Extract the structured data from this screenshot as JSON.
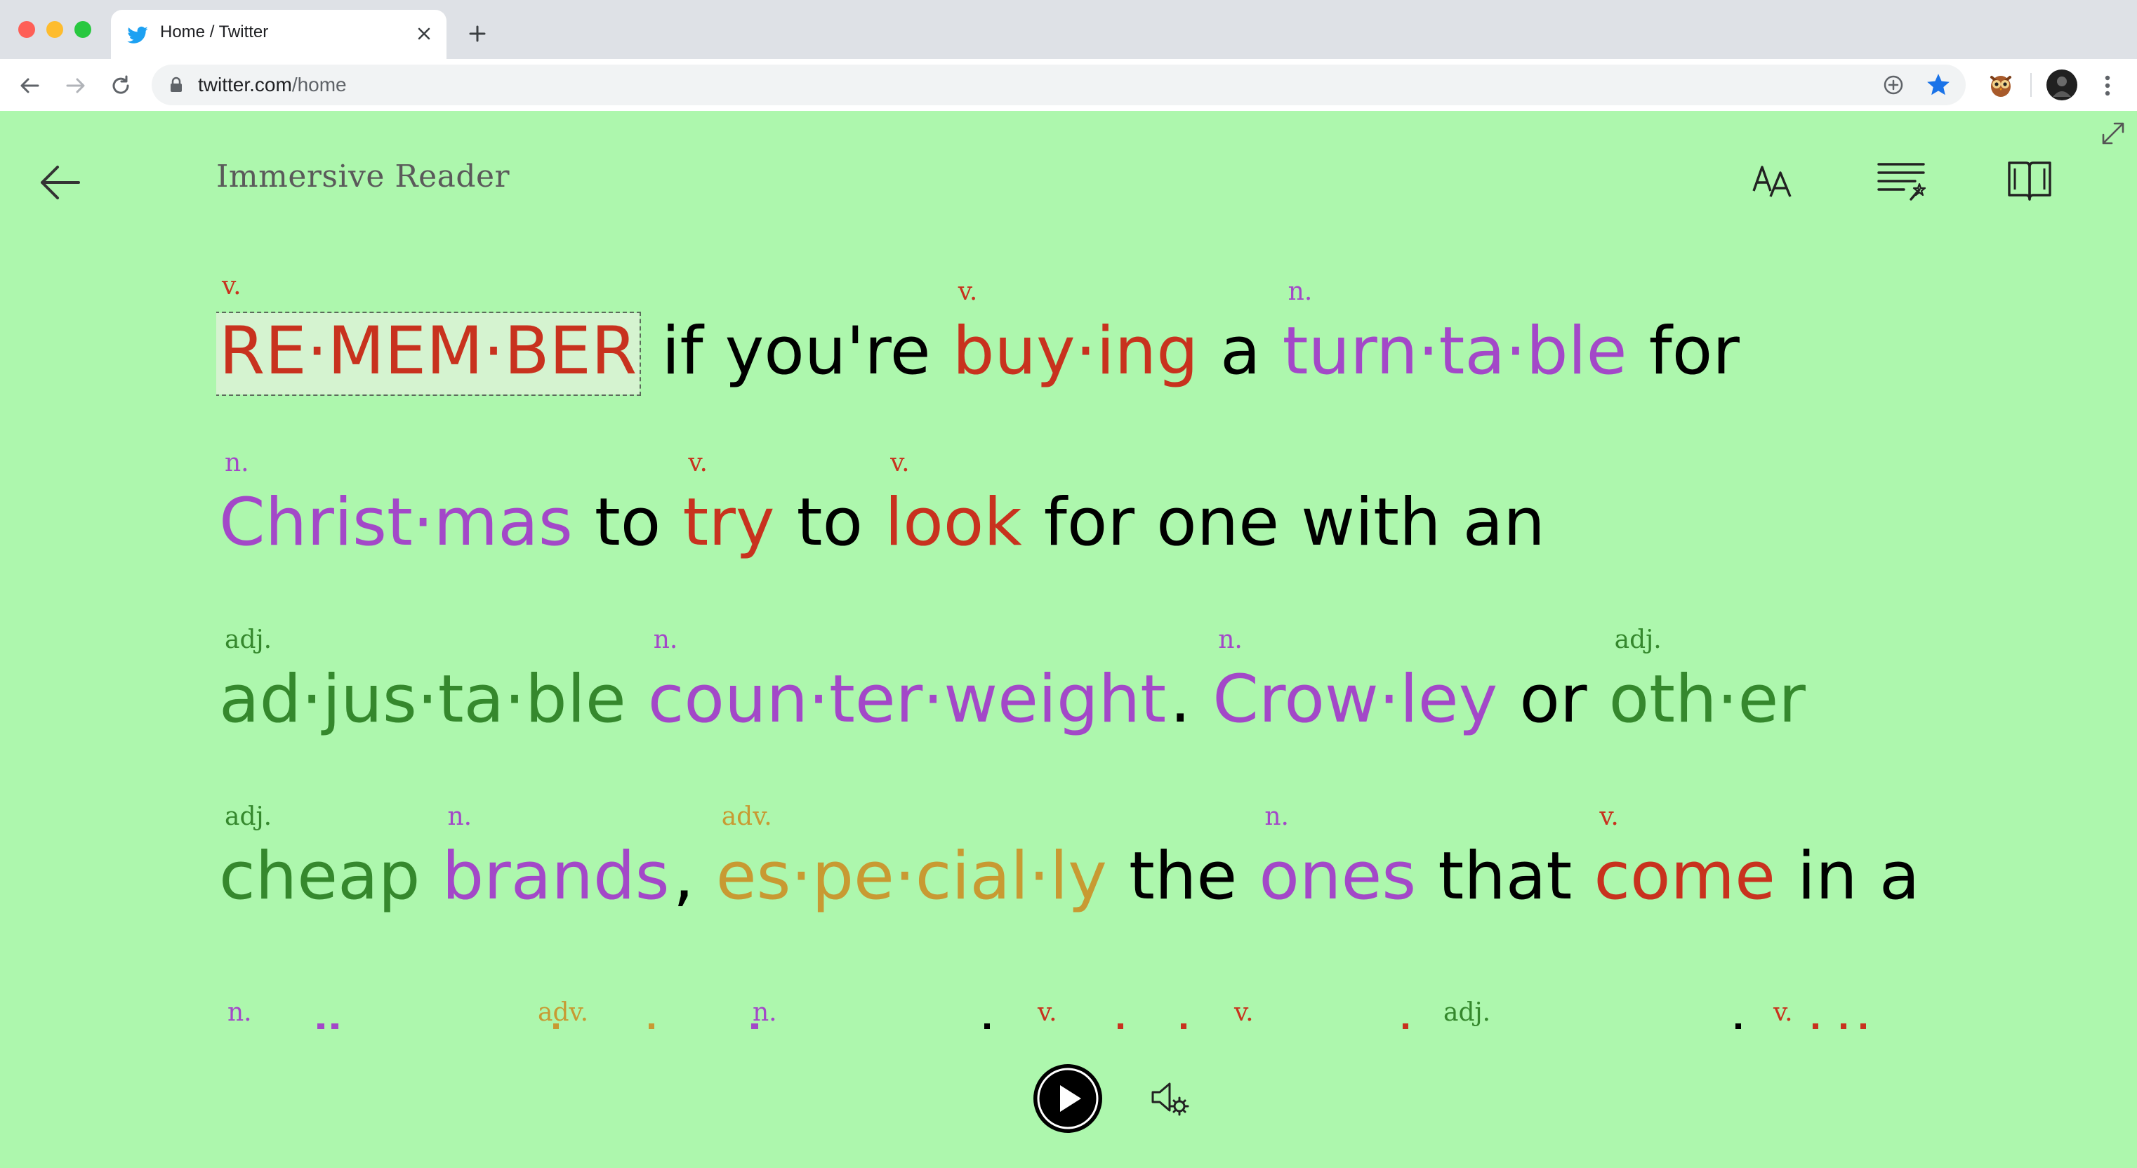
{
  "browser": {
    "tab_title": "Home / Twitter",
    "url_host": "twitter.com",
    "url_path": "/home"
  },
  "reader": {
    "title": "Immersive Reader",
    "lines": [
      [
        {
          "w": "RE·MEM·BER",
          "pos": "v."
        },
        {
          "w": "if"
        },
        {
          "w": "you're"
        },
        {
          "w": "buy·ing",
          "pos": "v."
        },
        {
          "w": "a"
        },
        {
          "w": "turn·ta·ble",
          "pos": "n."
        },
        {
          "w": "for"
        }
      ],
      [
        {
          "w": "Christ·mas",
          "pos": "n."
        },
        {
          "w": "to"
        },
        {
          "w": "try",
          "pos": "v."
        },
        {
          "w": "to"
        },
        {
          "w": "look",
          "pos": "v."
        },
        {
          "w": "for"
        },
        {
          "w": "one"
        },
        {
          "w": "with"
        },
        {
          "w": "an"
        }
      ],
      [
        {
          "w": "ad·jus·ta·ble",
          "pos": "adj."
        },
        {
          "w": "coun·ter·weight",
          "pos": "n."
        },
        {
          "w": ".",
          "punct": true
        },
        {
          "w": "Crow·ley",
          "pos": "n."
        },
        {
          "w": "or"
        },
        {
          "w": "oth·er",
          "pos": "adj."
        }
      ],
      [
        {
          "w": "cheap",
          "pos": "adj."
        },
        {
          "w": "brands",
          "pos": "n."
        },
        {
          "w": ",",
          "punct": true
        },
        {
          "w": "es·pe·cial·ly",
          "pos": "adv."
        },
        {
          "w": "the"
        },
        {
          "w": "ones",
          "pos": "n."
        },
        {
          "w": "that"
        },
        {
          "w": "come",
          "pos": "v."
        },
        {
          "w": "in"
        },
        {
          "w": "a"
        }
      ]
    ],
    "partial_line_labels": [
      "n.",
      "adv.",
      "n.",
      "v.",
      "v.",
      "adj.",
      "v."
    ],
    "colors": {
      "background": "#adf7ad",
      "verb": "#c8321e",
      "noun": "#a348c8",
      "adjective": "#35882d",
      "adverb": "#c89a32"
    },
    "icons": [
      "back-arrow-icon",
      "text-preferences-icon",
      "grammar-options-icon",
      "reading-preferences-icon",
      "expand-icon",
      "play-icon",
      "voice-settings-icon"
    ]
  }
}
